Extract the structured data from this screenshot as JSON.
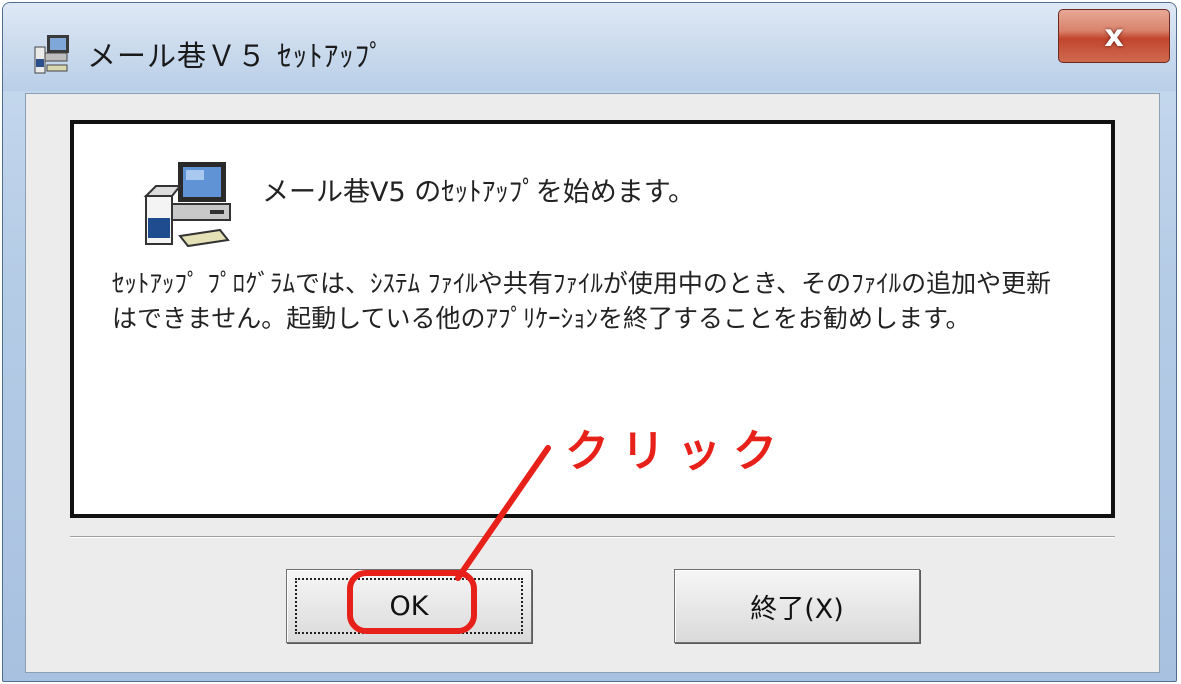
{
  "window": {
    "title": "メール巷Ｖ５ ｾｯﾄｱｯﾌﾟ",
    "close_label": "x"
  },
  "dialog": {
    "heading": "メール巷V5 のｾｯﾄｱｯﾌﾟを始めます。",
    "body": "ｾｯﾄｱｯﾌﾟ ﾌﾟﾛｸﾞﾗﾑでは、ｼｽﾃﾑ ﾌｧｲﾙや共有ﾌｧｲﾙが使用中のとき、そのﾌｧｲﾙの追加や更新はできません。起動している他のｱﾌﾟﾘｹｰｼｮﾝを終了することをお勧めします。"
  },
  "buttons": {
    "ok_label": "OK",
    "exit_label": "終了(X)"
  },
  "annotation": {
    "label": "クリック",
    "color": "#e8201a"
  },
  "colors": {
    "close_button": "#c2452d",
    "annotation": "#e8201a"
  }
}
